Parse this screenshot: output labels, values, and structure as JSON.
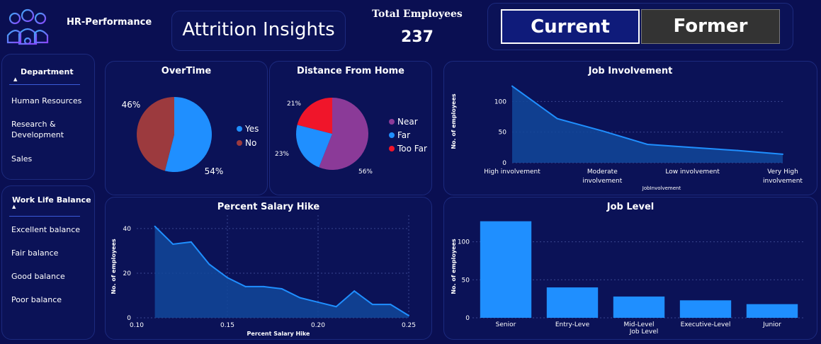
{
  "header": {
    "app_name": "HR-Performance",
    "dashboard_title": "Attrition Insights",
    "total_label": "Total Employees",
    "total_value": "237",
    "toggle_current": "Current",
    "toggle_former": "Former"
  },
  "filters": {
    "department": {
      "title": "Department",
      "items": [
        "Human Resources",
        "Research & Development",
        "Sales"
      ]
    },
    "work_life_balance": {
      "title": "Work Life Balance",
      "items": [
        "Excellent balance",
        "Fair balance",
        "Good balance",
        "Poor balance"
      ]
    }
  },
  "colors": {
    "background": "#0a0f52",
    "panel": "#0b1257",
    "accent_blue": "#1f8fff",
    "area_fill": "#12489a",
    "pie_no": "#9c3a3e",
    "pie_near": "#8b3a98",
    "pie_toofar": "#f0152a",
    "toggle_current": "#0f1b7a",
    "toggle_former": "#333333"
  },
  "chart_data": [
    {
      "id": "overtime",
      "type": "pie",
      "title": "OverTime",
      "labels": [
        "Yes",
        "No"
      ],
      "values": [
        54,
        46
      ],
      "value_labels": [
        "54%",
        "46%"
      ],
      "colors": [
        "#1f8fff",
        "#9c3a3e"
      ],
      "legend_position": "right"
    },
    {
      "id": "distance",
      "type": "pie",
      "title": "Distance From Home",
      "labels": [
        "Near",
        "Far",
        "Too Far"
      ],
      "values": [
        56,
        23,
        21
      ],
      "value_labels": [
        "56%",
        "23%",
        "21%"
      ],
      "colors": [
        "#8b3a98",
        "#1f8fff",
        "#f0152a"
      ],
      "legend_position": "right"
    },
    {
      "id": "job_involvement",
      "type": "area",
      "title": "Job Involvement",
      "xlabel": "JobInvolvement",
      "ylabel": "No. of employees",
      "categories": [
        "High involvement",
        "Moderate involvement",
        "Low involvement",
        "Very High involvement"
      ],
      "category_label_lines": [
        [
          "High involvement"
        ],
        [
          "Moderate",
          "involvement"
        ],
        [
          "Low involvement"
        ],
        [
          "Very High",
          "involvement"
        ]
      ],
      "x": [
        0,
        0.5,
        1,
        1.5,
        2,
        2.5,
        3
      ],
      "y": [
        125,
        72,
        52,
        30,
        25,
        20,
        14
      ],
      "yticks": [
        0,
        50,
        100
      ],
      "ylim": [
        0,
        135
      ],
      "grid": true
    },
    {
      "id": "salary_hike",
      "type": "area",
      "title": "Percent Salary Hike",
      "xlabel": "Percent Salary Hike",
      "ylabel": "No. of employees",
      "x": [
        0.11,
        0.12,
        0.13,
        0.14,
        0.15,
        0.16,
        0.17,
        0.18,
        0.19,
        0.2,
        0.21,
        0.22,
        0.23,
        0.24,
        0.25
      ],
      "y": [
        41,
        33,
        34,
        24,
        18,
        14,
        14,
        13,
        9,
        7,
        5,
        12,
        6,
        6,
        1
      ],
      "xticks": [
        "0.10",
        "0.15",
        "0.20",
        "0.25"
      ],
      "xtick_values": [
        0.1,
        0.15,
        0.2,
        0.25
      ],
      "yticks": [
        0,
        20,
        40
      ],
      "xlim": [
        0.1,
        0.25
      ],
      "ylim": [
        0,
        46
      ],
      "grid": true
    },
    {
      "id": "job_level",
      "type": "bar",
      "title": "Job Level",
      "xlabel": "Job Level",
      "ylabel": "No. of employees",
      "categories": [
        "Senior",
        "Entry-Leve",
        "Mid-Level",
        "Executive-Level",
        "Junior"
      ],
      "values": [
        127,
        40,
        28,
        23,
        18
      ],
      "yticks": [
        0,
        50,
        100
      ],
      "ylim": [
        0,
        135
      ],
      "grid": true
    }
  ]
}
